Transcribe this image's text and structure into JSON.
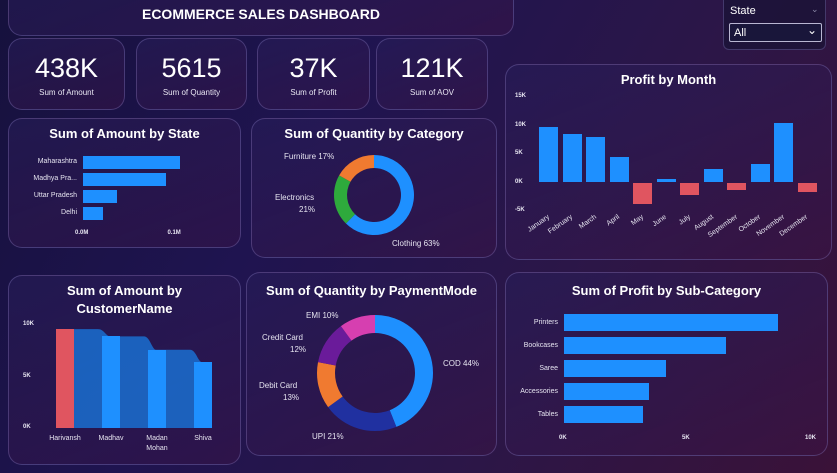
{
  "title": "ECOMMERCE SALES DASHBOARD",
  "kpis": [
    {
      "value": "438K",
      "label": "Sum of Amount"
    },
    {
      "value": "5615",
      "label": "Sum of Quantity"
    },
    {
      "value": "37K",
      "label": "Sum of Profit"
    },
    {
      "value": "121K",
      "label": "Sum of AOV"
    }
  ],
  "slicer": {
    "label": "State",
    "selected": "All"
  },
  "colors": {
    "blue": "#1e90ff",
    "red": "#e05560",
    "orange": "#f07a30",
    "green": "#2eaa3c",
    "purple": "#6a1b9a",
    "pink": "#d63fb0",
    "navy": "#2030a0"
  },
  "chart_data": [
    {
      "id": "amount_by_state",
      "type": "bar",
      "orientation": "horizontal",
      "title": "Sum of Amount by State",
      "categories": [
        "Maharashtra",
        "Madhya Pra...",
        "Uttar Pradesh",
        "Delhi"
      ],
      "values": [
        0.105,
        0.09,
        0.037,
        0.022
      ],
      "xticks": [
        "0.0M",
        "0.1M"
      ],
      "xlim": [
        0,
        0.106
      ]
    },
    {
      "id": "quantity_by_category",
      "type": "pie",
      "donut": true,
      "title": "Sum of Quantity by Category",
      "labels": [
        "Clothing 63%",
        "Electronics 21%",
        "Furniture 17%"
      ],
      "names": [
        "Clothing",
        "Electronics",
        "Furniture"
      ],
      "values": [
        63,
        21,
        17
      ],
      "colors": [
        "#1e90ff",
        "#2eaa3c",
        "#f07a30"
      ]
    },
    {
      "id": "profit_by_month",
      "type": "bar",
      "title": "Profit by Month",
      "categories": [
        "January",
        "February",
        "March",
        "April",
        "May",
        "June",
        "July",
        "August",
        "September",
        "October",
        "November",
        "December"
      ],
      "values": [
        9800,
        8500,
        7900,
        4400,
        -3800,
        600,
        -2200,
        2300,
        -1400,
        3300,
        10400,
        -1700
      ],
      "yticks": [
        "15K",
        "10K",
        "5K",
        "0K",
        "-5K"
      ],
      "ylim": [
        -5000,
        15000
      ]
    },
    {
      "id": "amount_by_customer",
      "type": "area",
      "title": "Sum of Amount by CustomerName",
      "categories": [
        "Harivansh",
        "Madhav",
        "Madan Mohan",
        "Shiva"
      ],
      "values": [
        9600,
        8900,
        7600,
        6400
      ],
      "yticks": [
        "10K",
        "5K",
        "0K"
      ],
      "ylim": [
        0,
        10000
      ]
    },
    {
      "id": "quantity_by_paymentmode",
      "type": "pie",
      "donut": true,
      "title": "Sum of Quantity by PaymentMode",
      "labels": [
        "COD 44%",
        "UPI 21%",
        "Debit Card 13%",
        "Credit Card 12%",
        "EMI 10%"
      ],
      "names": [
        "COD",
        "UPI",
        "Debit Card",
        "Credit Card",
        "EMI"
      ],
      "values": [
        44,
        21,
        13,
        12,
        10
      ],
      "colors": [
        "#1e90ff",
        "#2030a0",
        "#f07a30",
        "#6a1b9a",
        "#d63fb0"
      ]
    },
    {
      "id": "profit_by_subcategory",
      "type": "bar",
      "orientation": "horizontal",
      "title": "Sum of Profit by Sub-Category",
      "categories": [
        "Printers",
        "Bookcases",
        "Saree",
        "Accessories",
        "Tables"
      ],
      "values": [
        8700,
        6600,
        4150,
        3450,
        3200
      ],
      "xticks": [
        "0K",
        "5K",
        "10K"
      ],
      "xlim": [
        0,
        10000
      ]
    }
  ]
}
